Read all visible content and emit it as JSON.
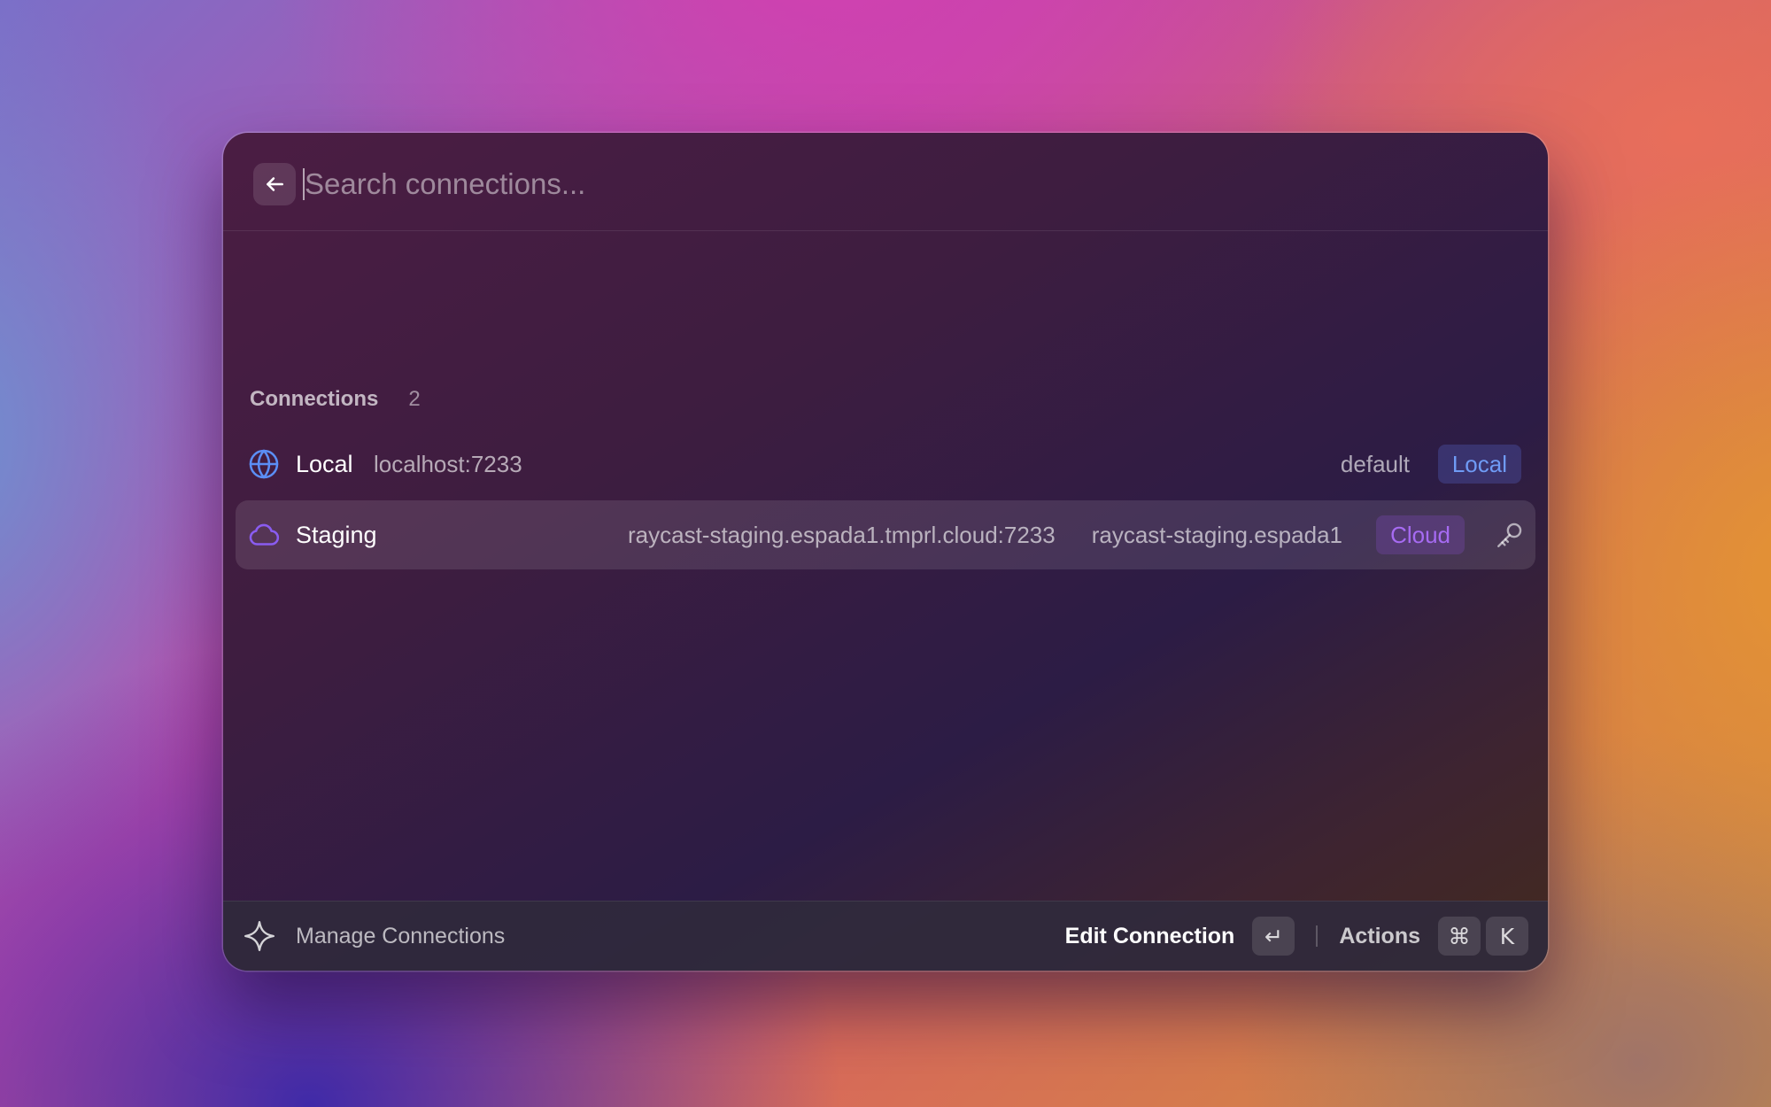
{
  "search": {
    "placeholder": "Search connections..."
  },
  "section": {
    "label": "Connections",
    "count": "2"
  },
  "rows": [
    {
      "icon": "globe-icon",
      "title": "Local",
      "subtitle": "localhost:7233",
      "accessory": "default",
      "tag": "Local",
      "tag_color": "#6f9bf5"
    },
    {
      "icon": "cloud-icon",
      "title": "Staging",
      "subtitle": "raycast-staging.espada1.tmprl.cloud:7233",
      "accessory": "raycast-staging.espada1",
      "tag": "Cloud",
      "tag_color": "#a66bf2",
      "trailing_icon": "key-icon",
      "selected": true
    }
  ],
  "footer": {
    "logo_icon": "raycast-logo-icon",
    "title": "Manage Connections",
    "primary_action": "Edit Connection",
    "primary_shortcut": "↵",
    "actions_label": "Actions",
    "actions_shortcut": [
      "⌘",
      "K"
    ]
  },
  "colors": {
    "globe_icon": "#5b8ef5",
    "cloud_icon": "#8a5cf0"
  }
}
